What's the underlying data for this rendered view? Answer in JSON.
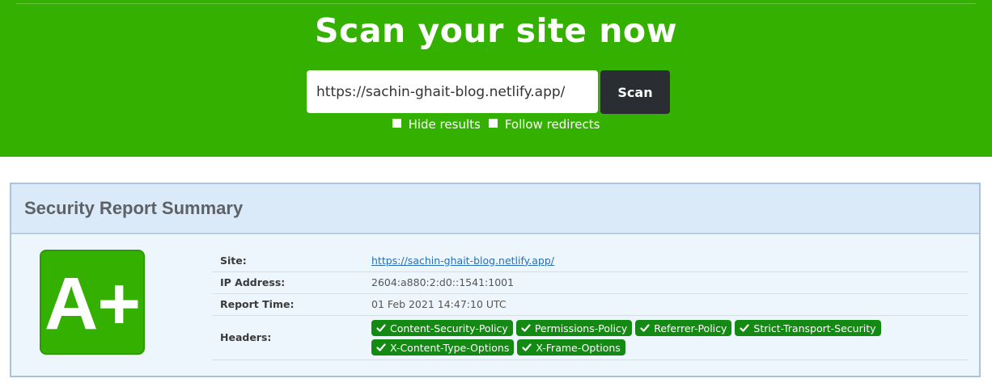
{
  "hero": {
    "title": "Scan your site now",
    "input_value": "https://sachin-ghait-blog.netlify.app/",
    "scan_label": "Scan",
    "hide_results_label": "Hide results",
    "follow_redirects_label": "Follow redirects"
  },
  "report": {
    "title": "Security Report Summary",
    "grade": "A+",
    "rows": {
      "site_label": "Site:",
      "site_value": "https://sachin-ghait-blog.netlify.app/",
      "ip_label": "IP Address:",
      "ip_value": "2604:a880:2:d0::1541:1001",
      "time_label": "Report Time:",
      "time_value": "01 Feb 2021 14:47:10 UTC",
      "headers_label": "Headers:"
    },
    "headers": [
      "Content-Security-Policy",
      "Permissions-Policy",
      "Referrer-Policy",
      "Strict-Transport-Security",
      "X-Content-Type-Options",
      "X-Frame-Options"
    ]
  },
  "colors": {
    "brand_green": "#34b000",
    "badge_green": "#138a12",
    "button_dark": "#2a2d31"
  }
}
